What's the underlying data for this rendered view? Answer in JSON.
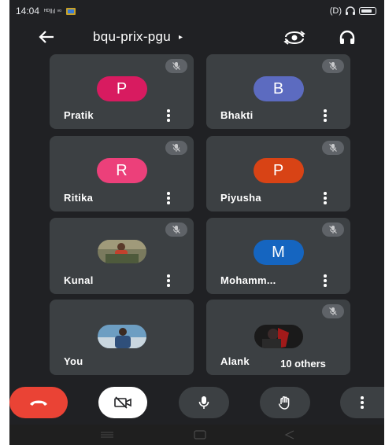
{
  "status_bar": {
    "time": "14:04",
    "indicators": "ᴴᴰ‖ıl ᵛᵒ",
    "right_glyphs": "(D)"
  },
  "header": {
    "meeting_code": "bqu-prix-pgu",
    "caret": "▸",
    "back_icon": "arrow-left-icon",
    "switch_camera_icon": "switch-camera-icon",
    "audio_icon": "headphones-icon"
  },
  "participants": [
    {
      "name": "Pratik",
      "initial": "P",
      "avatar_color": "#d81b60",
      "muted": true
    },
    {
      "name": "Bhakti",
      "initial": "B",
      "avatar_color": "#5c6bc0",
      "muted": true
    },
    {
      "name": "Ritika",
      "initial": "R",
      "avatar_color": "#ec407a",
      "muted": true
    },
    {
      "name": "Piyusha",
      "initial": "P",
      "avatar_color": "#d84315",
      "muted": true
    },
    {
      "name": "Kunal",
      "initial": "",
      "avatar_color": "#6d6d55",
      "muted": true
    },
    {
      "name": "Mohamm...",
      "initial": "M",
      "avatar_color": "#1565c0",
      "muted": true
    },
    {
      "name": "You",
      "initial": "",
      "avatar_color": "#5b8fb9",
      "muted": false
    },
    {
      "name": "Alank",
      "initial": "",
      "avatar_color": "#8b1a1a",
      "muted": true
    }
  ],
  "others_label": "10 others",
  "controls": {
    "end_call_color": "#ea4335",
    "end_call_icon": "phone-hangup-icon",
    "camera_icon": "camera-off-icon",
    "mic_icon": "microphone-icon",
    "hand_icon": "raise-hand-icon",
    "more_icon": "more-vert-icon"
  },
  "colors": {
    "background": "#202124",
    "tile": "#3c4043",
    "mute_pill": "#5f6368"
  }
}
